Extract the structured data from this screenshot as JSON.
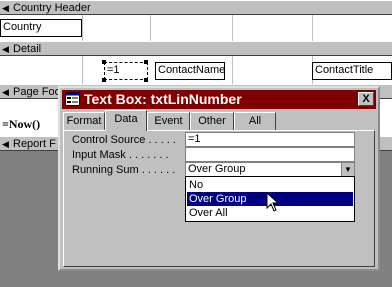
{
  "report": {
    "sections": {
      "country_header": "Country Header",
      "detail": "Detail",
      "page_footer": "Page Foo",
      "report_footer": "Report F"
    },
    "controls": {
      "country": "Country",
      "line_number": "=1",
      "contact_name": "ContactName",
      "contact_title": "ContactTitle",
      "now": "=Now()"
    }
  },
  "dialog": {
    "title": "Text Box: txtLinNumber",
    "close_label": "X",
    "tabs": [
      "Format",
      "Data",
      "Event",
      "Other",
      "All"
    ],
    "active_tab": "Data",
    "properties": [
      {
        "label": "Control Source . . . . .",
        "value": "=1"
      },
      {
        "label": "Input Mask . . . . . . .",
        "value": ""
      },
      {
        "label": "Running Sum . . . . . .",
        "value": "Over Group"
      }
    ],
    "running_sum_options": [
      "No",
      "Over Group",
      "Over All"
    ],
    "highlighted_option": "Over Group"
  }
}
